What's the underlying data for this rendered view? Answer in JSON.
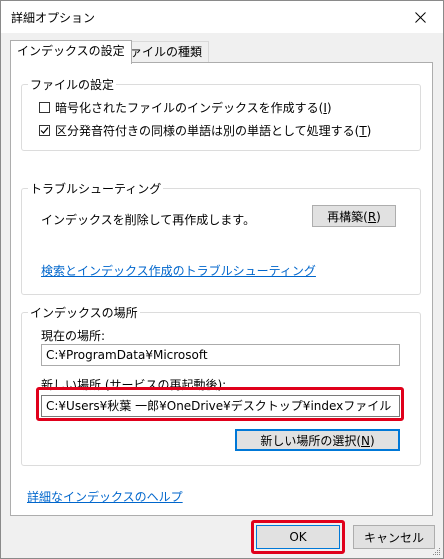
{
  "window": {
    "title": "詳細オプション"
  },
  "tabs": [
    {
      "label": "インデックスの設定",
      "active": true
    },
    {
      "label": "ファイルの種類",
      "active": false
    }
  ],
  "file_settings": {
    "title": "ファイルの設定",
    "encrypt_label": "暗号化されたファイルのインデックスを作成する(",
    "encrypt_key": "I",
    "encrypt_checked": false,
    "diacritic_label": "区分発音符付きの同様の単語は別の単語として処理する(",
    "diacritic_key": "T",
    "diacritic_checked": true,
    "closing_paren": ")"
  },
  "troubleshooting": {
    "title": "トラブルシューティング",
    "description": "インデックスを削除して再作成します。",
    "rebuild_label": "再構築(",
    "rebuild_key": "R",
    "closing_paren": ")",
    "link": "検索とインデックス作成のトラブルシューティング"
  },
  "index_location": {
    "title": "インデックスの場所",
    "current_label": "現在の場所:",
    "current_value": "C:¥ProgramData¥Microsoft",
    "new_label": "新しい場所 (サービスの再起動後):",
    "new_value": "C:¥Users¥秋葉 一郎¥OneDrive¥デスクトップ¥indexファイル",
    "select_label": "新しい場所の選択(",
    "select_key": "N",
    "closing_paren": ")"
  },
  "help_link": "詳細なインデックスのヘルプ",
  "footer": {
    "ok": "OK",
    "cancel": "キャンセル"
  },
  "colors": {
    "highlight": "#e0001b",
    "link": "#0066cc",
    "focus": "#0078d7"
  },
  "icons": {
    "close": "close-icon",
    "check": "checkmark-icon",
    "grip": "resize-grip-icon"
  }
}
